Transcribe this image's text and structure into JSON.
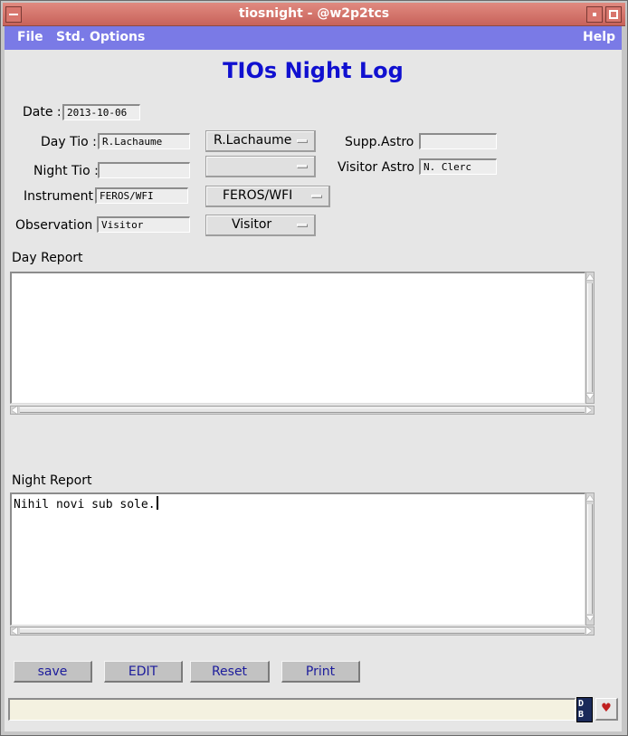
{
  "window": {
    "title": "tiosnight - @w2p2tcs"
  },
  "menubar": {
    "file": "File",
    "std_options": "Std. Options",
    "help": "Help"
  },
  "heading": "TIOs Night Log",
  "form": {
    "date_label": "Date :",
    "date_value": "2013-10-06",
    "day_tio_label": "Day Tio :",
    "day_tio_value": "R.Lachaume",
    "day_tio_option": "R.Lachaume",
    "night_tio_label": "Night Tio :",
    "night_tio_value": "",
    "night_tio_option": "",
    "instrument_label": "Instrument :",
    "instrument_value": "FEROS/WFI",
    "instrument_option": "FEROS/WFI",
    "observation_label": "Observation :",
    "observation_value": "Visitor",
    "observation_option": "Visitor",
    "supp_astro_label": "Supp.Astro :",
    "supp_astro_value": "",
    "visitor_astro_label": "Visitor Astro :",
    "visitor_astro_value": "N. Clerc"
  },
  "day_report": {
    "label": "Day Report",
    "text": ""
  },
  "night_report": {
    "label": "Night Report",
    "text": "Nihil novi sub sole."
  },
  "buttons": {
    "save": "save",
    "edit": "EDIT",
    "reset": "Reset",
    "print": "Print"
  },
  "statusbar": {
    "text": "",
    "db_icon_text": "D B"
  },
  "colors": {
    "titlebar": "#d0706a",
    "menubar": "#7a7ae6",
    "heading": "#1010d0",
    "button_text": "#1c1c9c",
    "background": "#e6e6e6"
  },
  "icons": {
    "window_menu": "minus-icon",
    "maximize": "square-dot-icon",
    "close": "square-icon",
    "database": "db-icon",
    "status_heart": "heart-icon",
    "dropdown_indicator": "option-menu-indicator-icon"
  }
}
